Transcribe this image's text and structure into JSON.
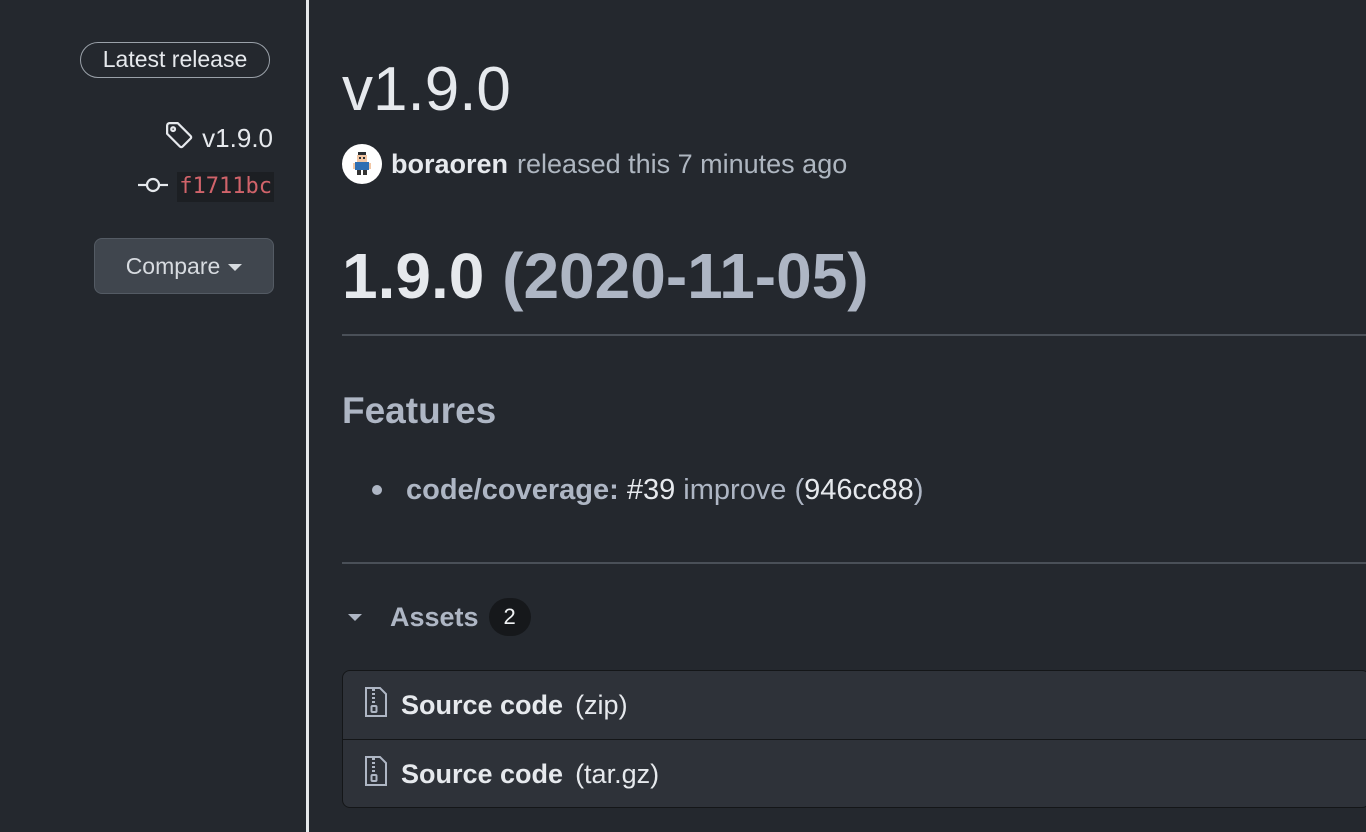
{
  "sidebar": {
    "latest_badge": "Latest release",
    "tag": "v1.9.0",
    "commit": "f1711bc",
    "compare_label": "Compare"
  },
  "release": {
    "title": "v1.9.0",
    "author": "boraoren",
    "released_text": "released this 7 minutes ago"
  },
  "notes": {
    "heading_version": "1.9.0",
    "heading_date": "(2020-11-05)",
    "section_title": "Features",
    "features": [
      {
        "scope": "code/coverage:",
        "issue": "#39",
        "description": "improve",
        "open_paren": "(",
        "commit": "946cc88",
        "close_paren": ")"
      }
    ]
  },
  "assets": {
    "label": "Assets",
    "count": "2",
    "items": [
      {
        "name": "Source code",
        "type": "(zip)"
      },
      {
        "name": "Source code",
        "type": "(tar.gz)"
      }
    ]
  },
  "colors": {
    "background": "#24282e",
    "commit_sha": "#d0636a",
    "divider": "#e6e8ea"
  }
}
